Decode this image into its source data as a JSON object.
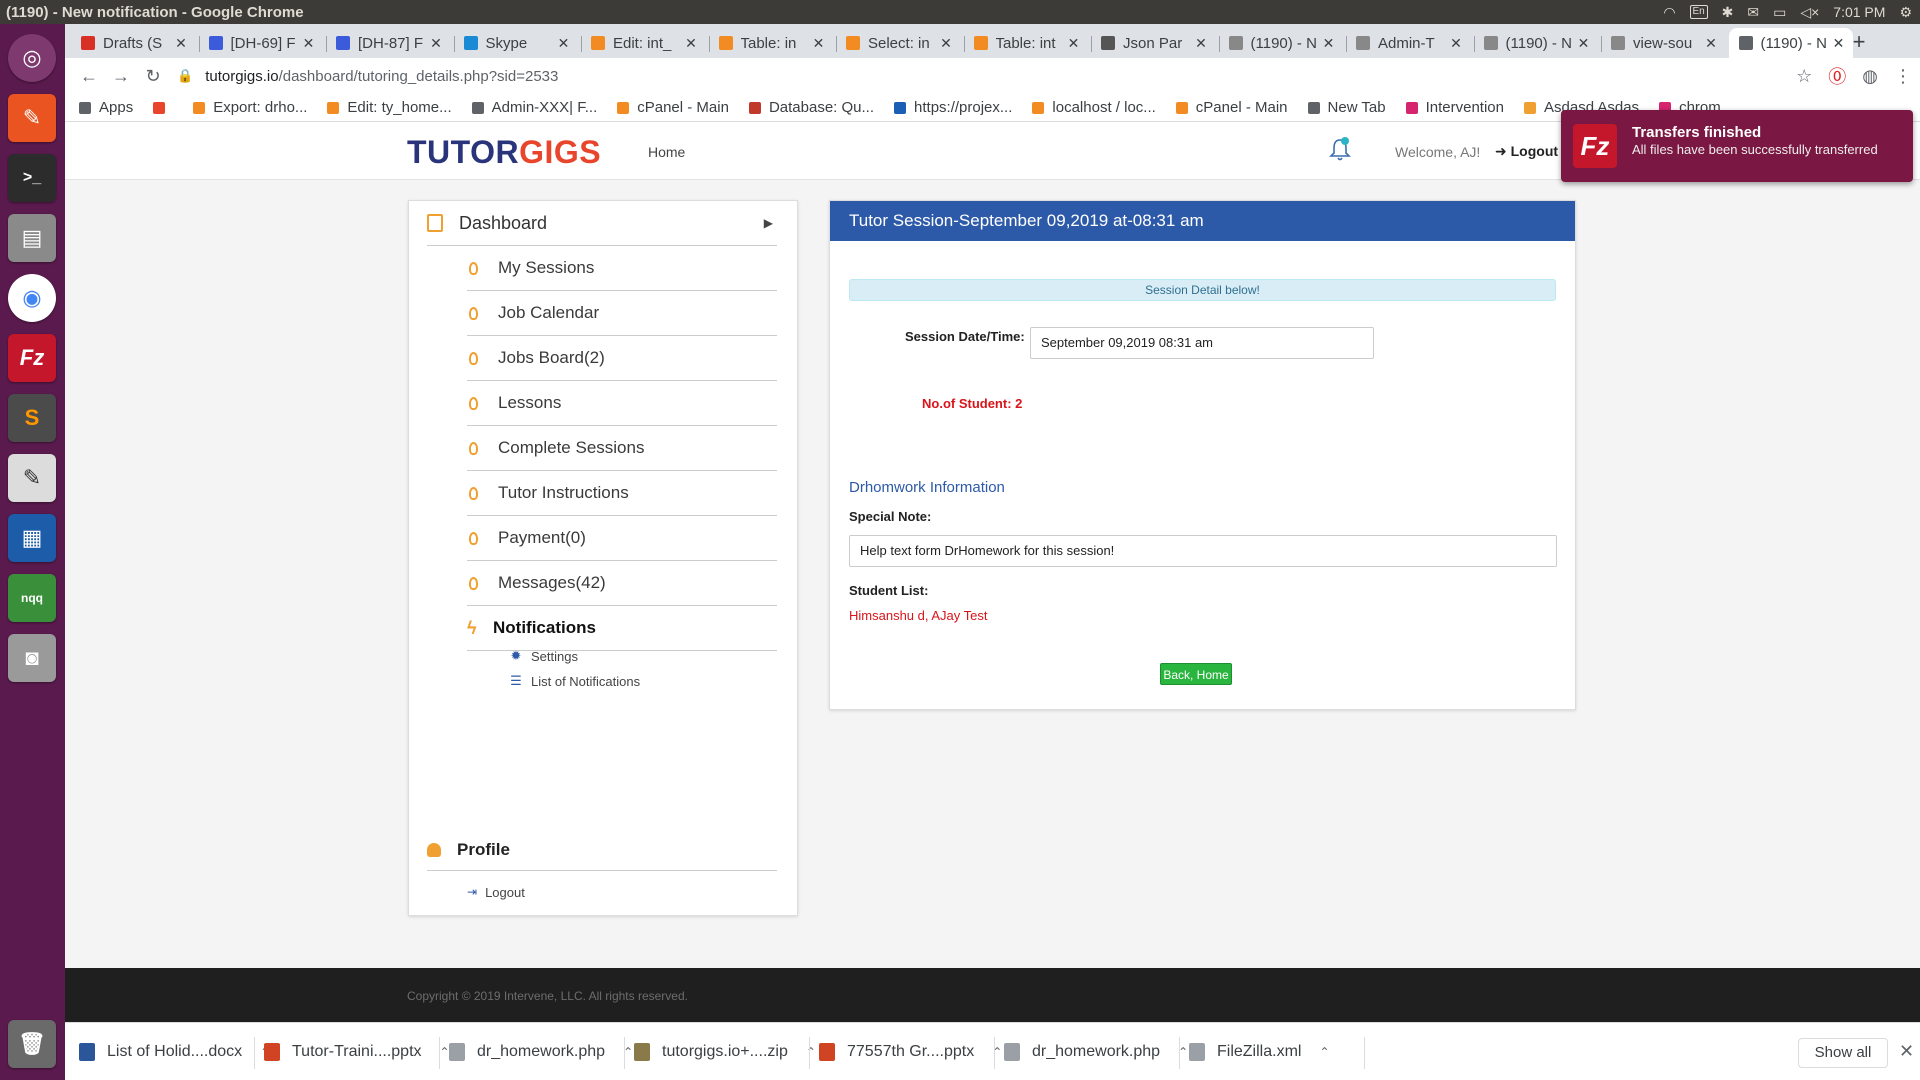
{
  "os": {
    "window_title": "(1190) - New notification - Google Chrome",
    "keyboard": "En",
    "time": "7:01 PM"
  },
  "tabs": [
    {
      "label": "Drafts (S",
      "icon": "gmail-icon",
      "color": "#d93025"
    },
    {
      "label": "[DH-69] F",
      "icon": "jira-icon",
      "color": "#3b5bdb"
    },
    {
      "label": "[DH-87] F",
      "icon": "jira-icon",
      "color": "#3b5bdb"
    },
    {
      "label": "Skype",
      "icon": "skype-icon",
      "color": "#1a8ad4"
    },
    {
      "label": "Edit: int_",
      "icon": "phpmyadmin-icon",
      "color": "#f28b22"
    },
    {
      "label": "Table: in",
      "icon": "phpmyadmin-icon",
      "color": "#f28b22"
    },
    {
      "label": "Select: in",
      "icon": "phpmyadmin-icon",
      "color": "#f28b22"
    },
    {
      "label": "Table: int",
      "icon": "phpmyadmin-icon",
      "color": "#f28b22"
    },
    {
      "label": "Json Par",
      "icon": "json-icon",
      "color": "#555555"
    },
    {
      "label": "(1190) - N",
      "icon": "site-icon",
      "color": "#888888"
    },
    {
      "label": "Admin-T",
      "icon": "site-icon",
      "color": "#888888"
    },
    {
      "label": "(1190) - N",
      "icon": "site-icon",
      "color": "#888888"
    },
    {
      "label": "view-sou",
      "icon": "site-icon",
      "color": "#888888"
    },
    {
      "label": "(1190) - N",
      "icon": "globe-icon",
      "color": "#5f6368",
      "active": true
    }
  ],
  "url": {
    "host": "tutorgigs.io",
    "path": "/dashboard/tutoring_details.php?sid=2533"
  },
  "bookmarks": [
    {
      "label": "Apps",
      "icon": "apps-icon",
      "color": "#5f6368"
    },
    {
      "label": "",
      "icon": "fire-icon",
      "color": "#e8452c"
    },
    {
      "label": "Export: drho...",
      "icon": "phpmyadmin-icon",
      "color": "#f28b22"
    },
    {
      "label": "Edit: ty_home...",
      "icon": "phpmyadmin-icon",
      "color": "#f28b22"
    },
    {
      "label": "Admin-XXX| F...",
      "icon": "globe-icon",
      "color": "#5f6368"
    },
    {
      "label": "cPanel - Main",
      "icon": "cpanel-icon",
      "color": "#f28b22"
    },
    {
      "label": "Database: Qu...",
      "icon": "db-icon",
      "color": "#c0392b"
    },
    {
      "label": "https://projex...",
      "icon": "projex-icon",
      "color": "#1a5fb4"
    },
    {
      "label": "localhost / loc...",
      "icon": "phpmyadmin-icon",
      "color": "#f28b22"
    },
    {
      "label": "cPanel - Main",
      "icon": "cpanel-icon",
      "color": "#f28b22"
    },
    {
      "label": "New Tab",
      "icon": "globe-icon",
      "color": "#5f6368"
    },
    {
      "label": "Intervention",
      "icon": "intervention-icon",
      "color": "#d6246e"
    },
    {
      "label": "Asdasd Asdas",
      "icon": "site-icon",
      "color": "#f0a030"
    },
    {
      "label": "chrom",
      "icon": "site-icon",
      "color": "#d6246e"
    }
  ],
  "site": {
    "logo_part1": "TUTOR",
    "logo_part2": "GIGS",
    "nav_home": "Home",
    "welcome": "Welcome, AJ!",
    "logout": "Logout"
  },
  "sidebar": {
    "dashboard": "Dashboard",
    "items": [
      {
        "label": "My Sessions"
      },
      {
        "label": "Job Calendar"
      },
      {
        "label": "Jobs Board(2)"
      },
      {
        "label": "Lessons"
      },
      {
        "label": "Complete Sessions"
      },
      {
        "label": "Tutor Instructions"
      },
      {
        "label": "Payment(0)"
      },
      {
        "label": "Messages(42)"
      }
    ],
    "notifications": "Notifications",
    "sub": [
      {
        "label": "Settings",
        "icon": "gear-icon"
      },
      {
        "label": "List of Notifications",
        "icon": "list-icon"
      }
    ],
    "profile": "Profile",
    "logout": "Logout"
  },
  "session": {
    "header": "Tutor Session-September 09,2019 at-08:31 am",
    "alert": "Session Detail below!",
    "datetime_label": "Session Date/Time:",
    "datetime_value": "September 09,2019 08:31 am",
    "num_students": "No.of Student: 2",
    "info_title": "Drhomwork Information",
    "note_label": "Special Note:",
    "note_value": "Help text form DrHomework for this session!",
    "students_label": "Student List:",
    "students": "Himsanshu d, AJay Test",
    "back_button": "Back, Home"
  },
  "footer": {
    "copyright": "Copyright © 2019 Intervene, LLC. All rights reserved."
  },
  "toast": {
    "title": "Transfers finished",
    "body": "All files have been successfully transferred"
  },
  "downloads": [
    {
      "label": "List of Holid....docx",
      "icon": "word-icon",
      "color": "#2b579a"
    },
    {
      "label": "Tutor-Traini....pptx",
      "icon": "ppt-icon",
      "color": "#d04423"
    },
    {
      "label": "dr_homework.php",
      "icon": "file-icon",
      "color": "#9aa0a6"
    },
    {
      "label": "tutorgigs.io+....zip",
      "icon": "zip-icon",
      "color": "#8a7a4a"
    },
    {
      "label": "77557th Gr....pptx",
      "icon": "ppt-icon",
      "color": "#d04423"
    },
    {
      "label": "dr_homework.php",
      "icon": "file-icon",
      "color": "#9aa0a6"
    },
    {
      "label": "FileZilla.xml",
      "icon": "file-icon",
      "color": "#9aa0a6"
    }
  ],
  "show_all": "Show all"
}
